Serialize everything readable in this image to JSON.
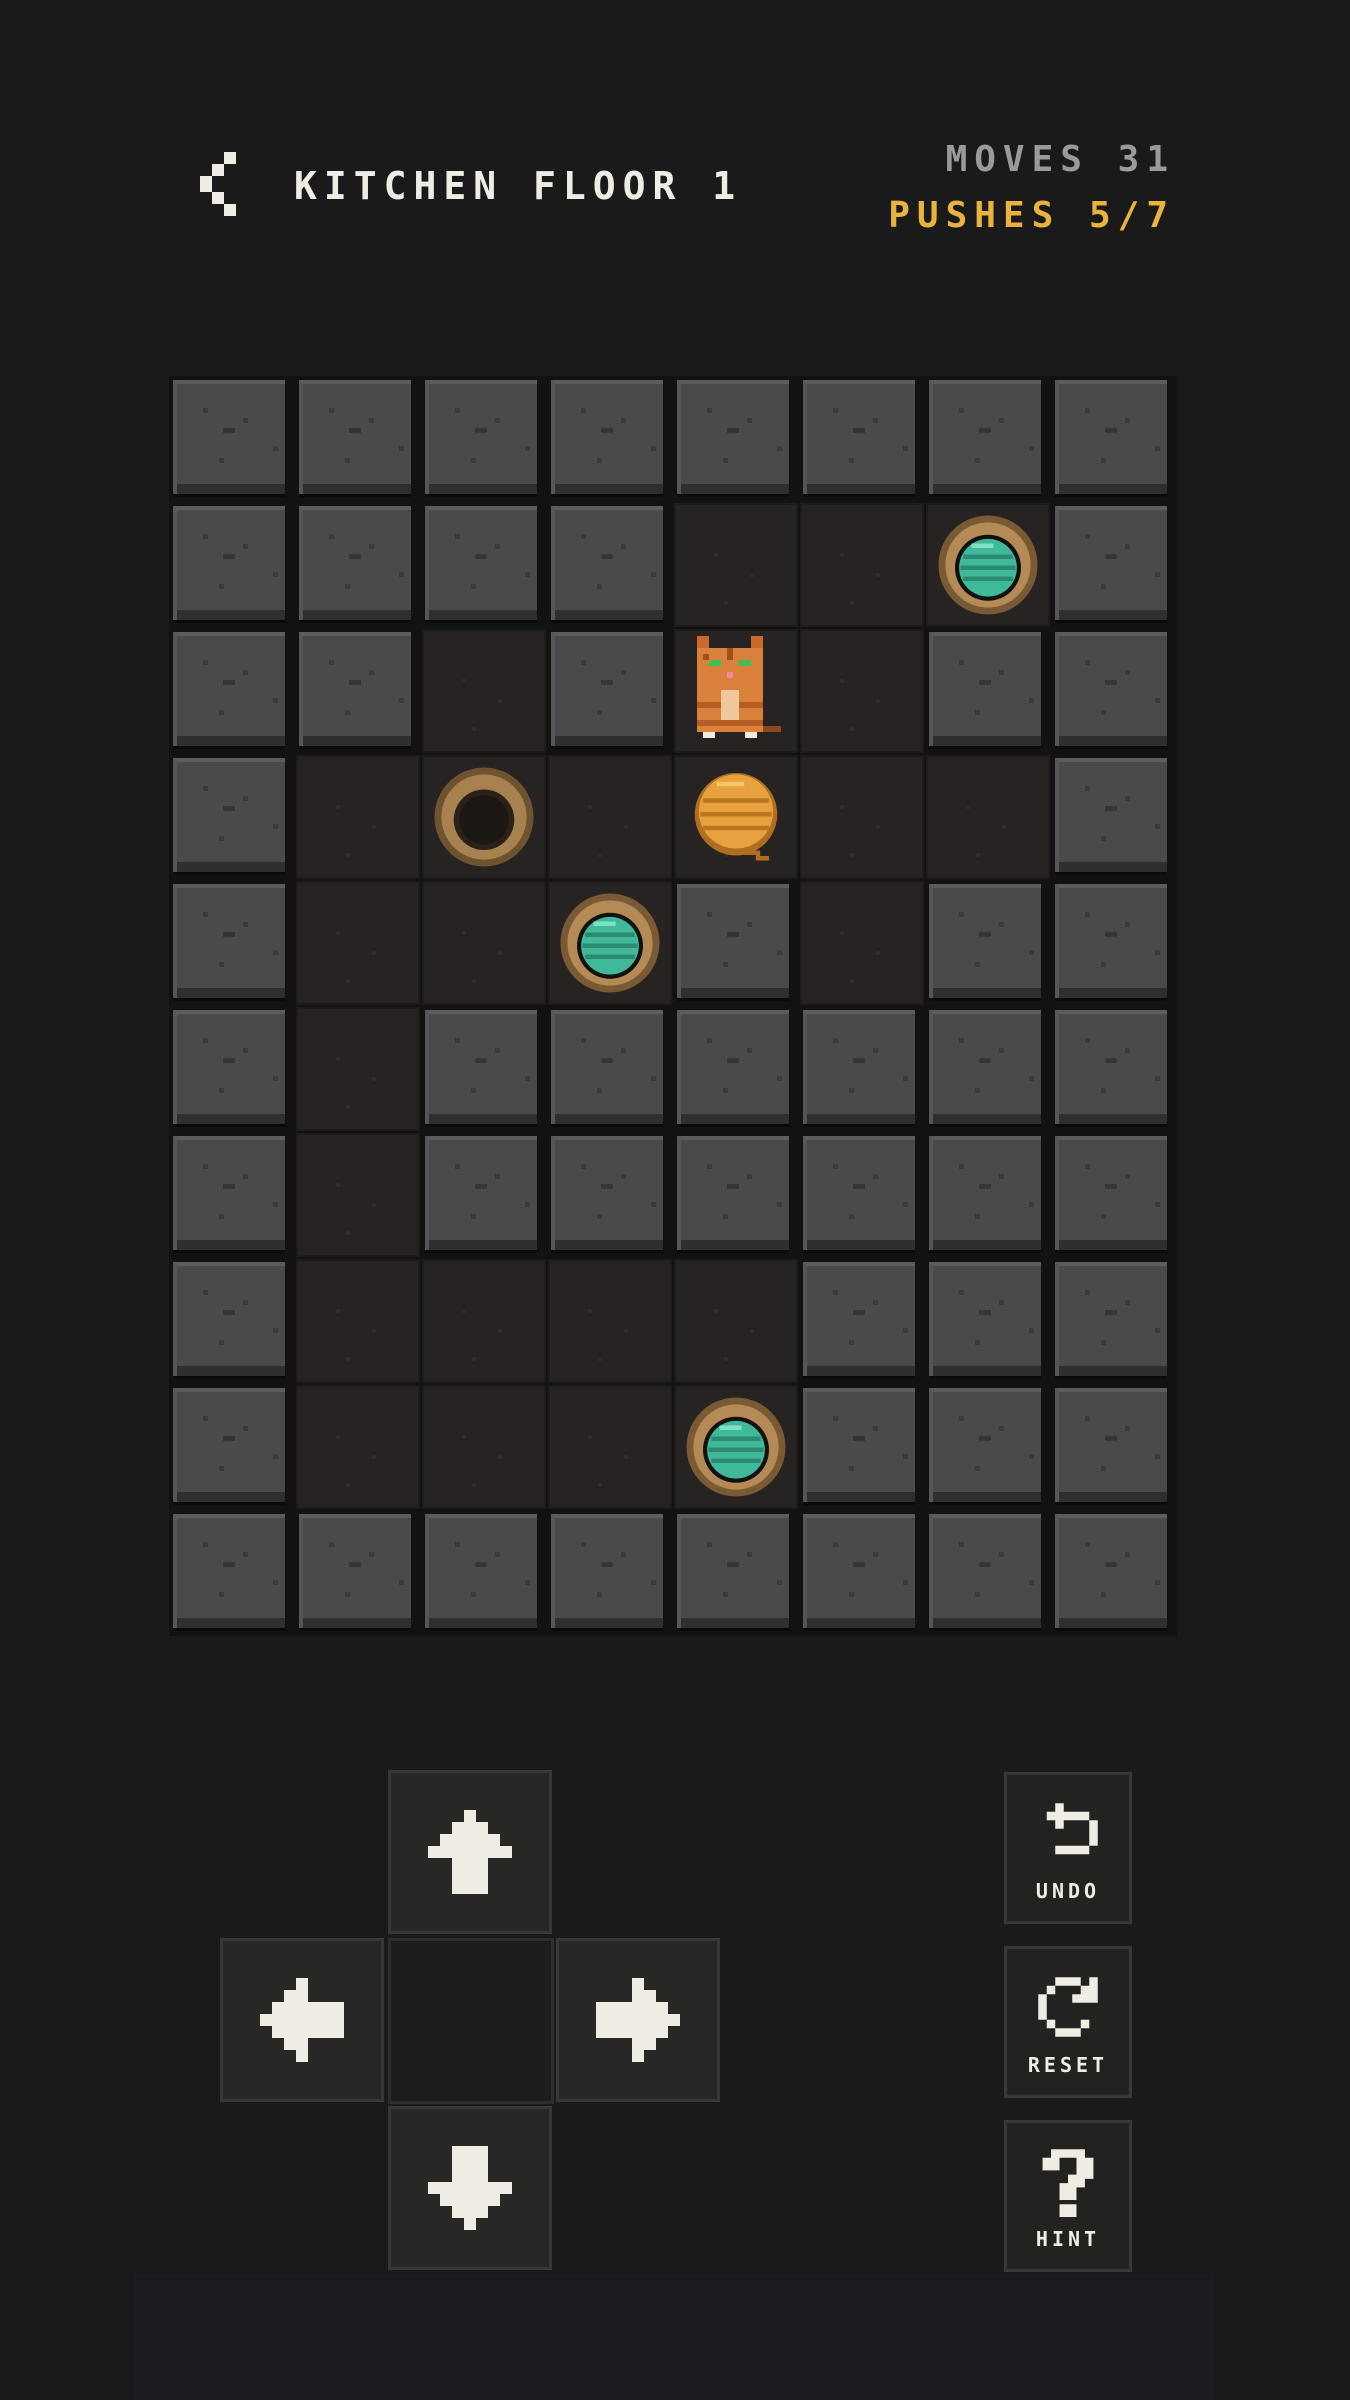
{
  "header": {
    "title": "KITCHEN FLOOR 1",
    "moves_label": "MOVES",
    "moves_value": "31",
    "pushes_label": "PUSHES",
    "pushes_value": "5/7"
  },
  "board": {
    "columns": 8,
    "rows": 10,
    "legend": {
      "W": "wall",
      "_": "floor",
      "T": "target-empty",
      "F": "target-filled-yarn",
      "B": "yarn-ball",
      "C": "cat"
    },
    "grid": [
      "WWWWWWWW",
      "WWWW__FW",
      "WW_WC_WW",
      "W_T_B__W",
      "W__FW_WW",
      "W_WWWWWW",
      "W_WWWWWW",
      "W____WWW",
      "W___FWWW",
      "WWWWWWWW"
    ]
  },
  "controls": {
    "dpad": [
      "up",
      "left",
      "right",
      "down"
    ],
    "undo_label": "UNDO",
    "reset_label": "RESET",
    "hint_label": "HINT"
  },
  "colors": {
    "background": "#1a1a1b",
    "accent": "#e9b33e",
    "wall": "#4a4a4c",
    "floor": "#262322",
    "yarn_orange": "#e7a23f",
    "yarn_teal": "#3fb99a"
  }
}
